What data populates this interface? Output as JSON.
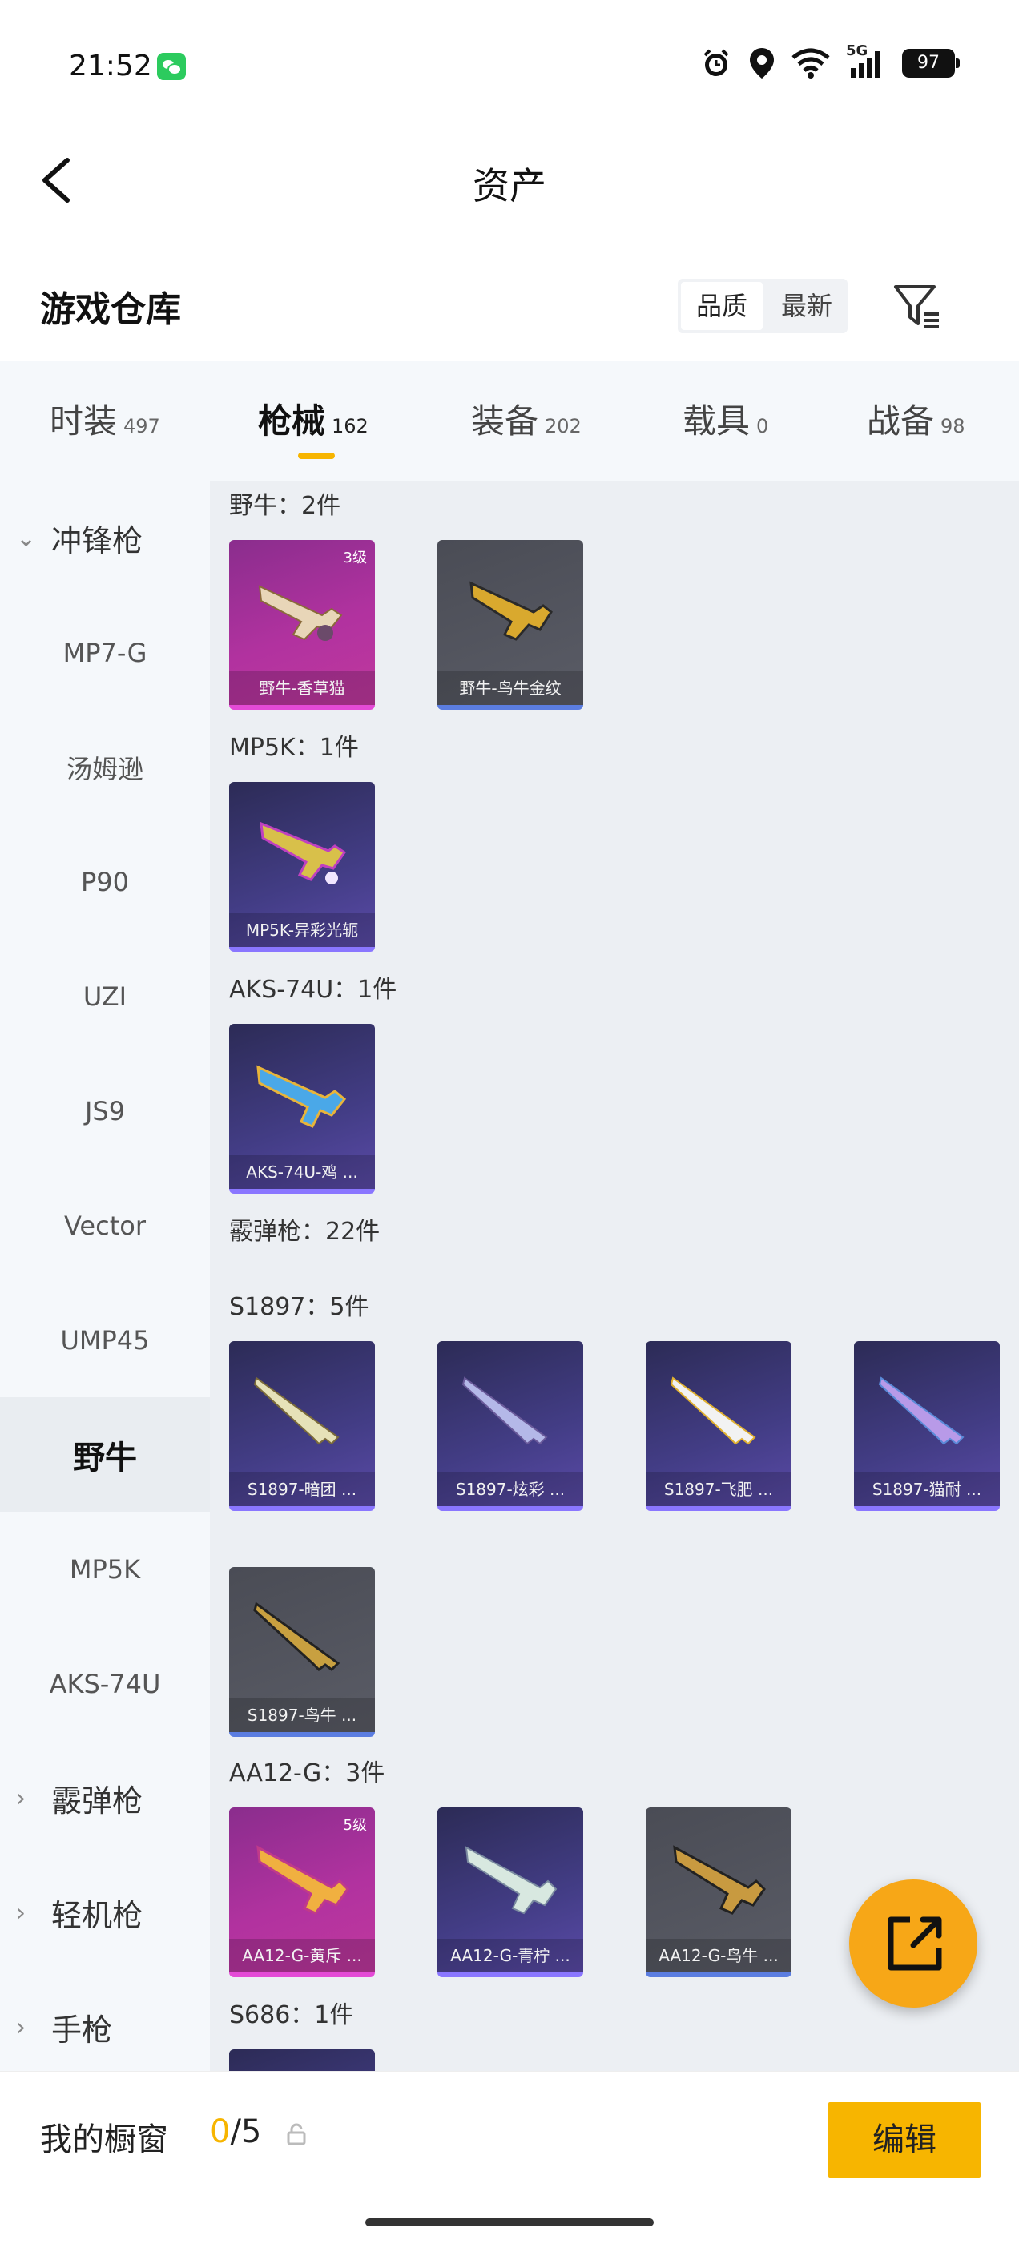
{
  "status_bar": {
    "time": "21:52",
    "network": "5G",
    "battery": "97",
    "icons": [
      "wechat-icon",
      "alarm-icon",
      "location-icon",
      "wifi-icon",
      "signal-icon",
      "battery-icon"
    ]
  },
  "nav": {
    "title": "资产",
    "back_icon": "chevron-left-icon"
  },
  "warehouse": {
    "title": "游戏仓库",
    "sort_options": [
      "品质",
      "最新"
    ],
    "active_sort": "品质",
    "filter_icon": "filter-icon"
  },
  "tabs": [
    {
      "label": "时装",
      "count": "497"
    },
    {
      "label": "枪械",
      "count": "162"
    },
    {
      "label": "装备",
      "count": "202"
    },
    {
      "label": "载具",
      "count": "0"
    },
    {
      "label": "战备",
      "count": "98"
    }
  ],
  "active_tab": "枪械",
  "sidebar": {
    "items": [
      {
        "label": "冲锋枪",
        "type": "category",
        "expanded": true
      },
      {
        "label": "MP7-G",
        "type": "item"
      },
      {
        "label": "汤姆逊",
        "type": "item"
      },
      {
        "label": "P90",
        "type": "item"
      },
      {
        "label": "UZI",
        "type": "item"
      },
      {
        "label": "JS9",
        "type": "item"
      },
      {
        "label": "Vector",
        "type": "item"
      },
      {
        "label": "UMP45",
        "type": "item"
      },
      {
        "label": "野牛",
        "type": "item",
        "active": true
      },
      {
        "label": "MP5K",
        "type": "item"
      },
      {
        "label": "AKS-74U",
        "type": "item"
      },
      {
        "label": "霰弹枪",
        "type": "category",
        "expanded": false
      },
      {
        "label": "轻机枪",
        "type": "category",
        "expanded": false
      },
      {
        "label": "手枪",
        "type": "category",
        "expanded": false
      }
    ]
  },
  "content": {
    "groups": [
      {
        "title": "野牛：2件",
        "cards": [
          {
            "caption": "野牛-香草猫",
            "quality": "purple",
            "tier": "3级"
          },
          {
            "caption": "野牛-鸟牛金纹",
            "quality": "gray",
            "tier": ""
          }
        ]
      },
      {
        "title": "MP5K：1件",
        "cards": [
          {
            "caption": "MP5K-异彩光轭",
            "quality": "blue",
            "tier": ""
          }
        ]
      },
      {
        "title": "AKS-74U：1件",
        "cards": [
          {
            "caption": "AKS-74U-鸡 ...",
            "quality": "blue",
            "tier": ""
          }
        ]
      },
      {
        "title": "霰弹枪：22件",
        "cards": []
      },
      {
        "title": "S1897：5件",
        "cards": [
          {
            "caption": "S1897-暗团 ...",
            "quality": "blue",
            "tier": ""
          },
          {
            "caption": "S1897-炫彩 ...",
            "quality": "blue",
            "tier": ""
          },
          {
            "caption": "S1897-飞肥 ...",
            "quality": "blue",
            "tier": ""
          },
          {
            "caption": "S1897-猫耐 ...",
            "quality": "blue",
            "tier": ""
          },
          {
            "caption": "S1897-鸟牛 ...",
            "quality": "gray",
            "tier": ""
          }
        ]
      },
      {
        "title": "AA12-G：3件",
        "cards": [
          {
            "caption": "AA12-G-黄斥 ...",
            "quality": "purple",
            "tier": "5级"
          },
          {
            "caption": "AA12-G-青柠 ...",
            "quality": "blue",
            "tier": ""
          },
          {
            "caption": "AA12-G-鸟牛 ...",
            "quality": "gray",
            "tier": ""
          }
        ]
      },
      {
        "title": "S686：1件",
        "cards": [
          {
            "caption": "",
            "quality": "blue",
            "tier": ""
          }
        ]
      }
    ]
  },
  "fab": {
    "icon": "share-external-icon"
  },
  "bottom_bar": {
    "showcase_label": "我的橱窗",
    "showcase_current": "0",
    "showcase_total": "/5",
    "lock_icon": "lock-icon",
    "edit_label": "编辑"
  },
  "colors": {
    "accent": "#f7b500",
    "fab": "#f7a717",
    "quality_purple": "#b1329f",
    "quality_blue": "#433d86",
    "quality_gray": "#55575f"
  }
}
